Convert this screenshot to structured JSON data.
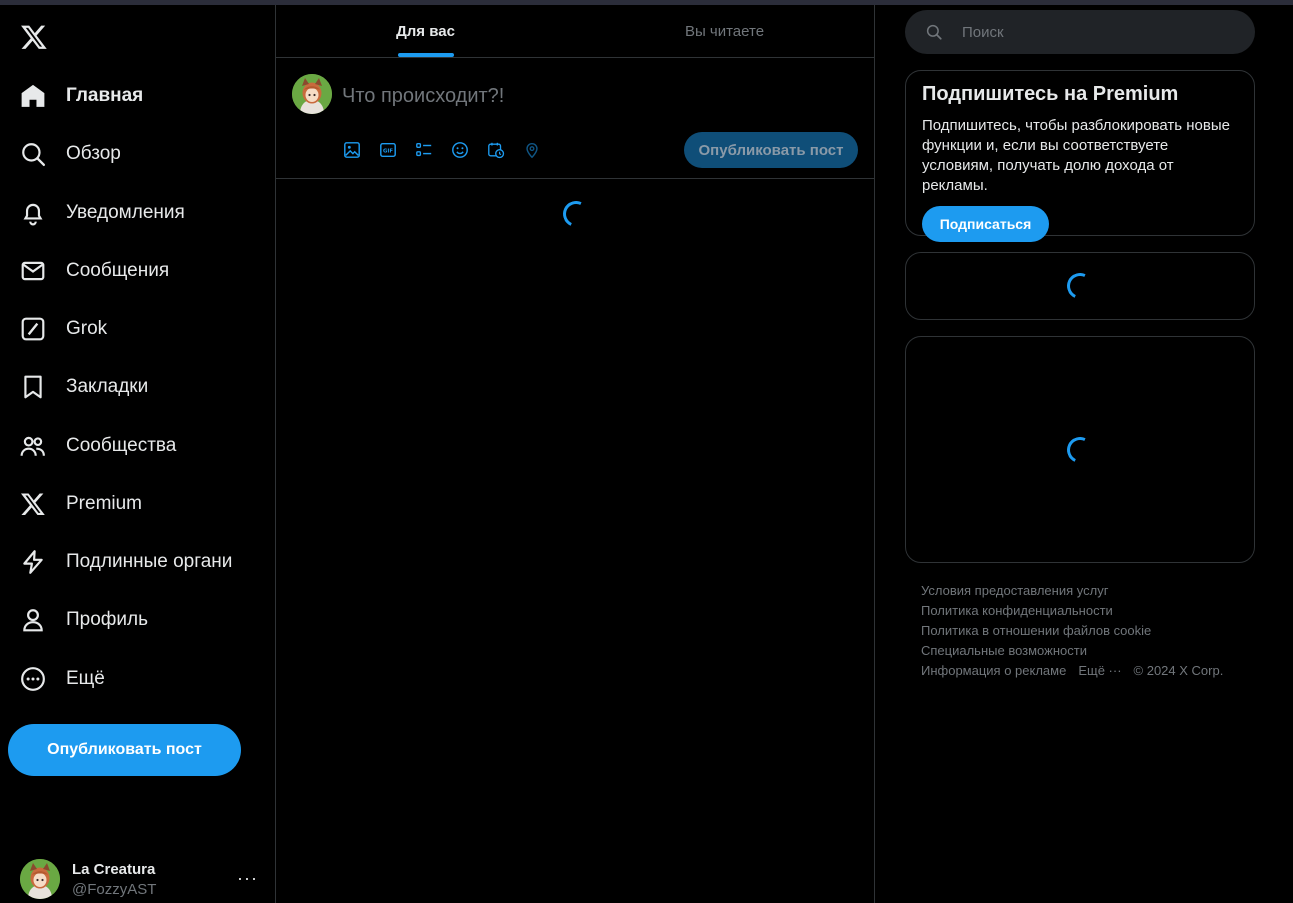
{
  "nav": {
    "items": [
      {
        "label": "Главная",
        "icon": "home-icon"
      },
      {
        "label": "Обзор",
        "icon": "search-icon"
      },
      {
        "label": "Уведомления",
        "icon": "bell-icon"
      },
      {
        "label": "Сообщения",
        "icon": "envelope-icon"
      },
      {
        "label": "Grok",
        "icon": "grok-icon"
      },
      {
        "label": "Закладки",
        "icon": "bookmark-icon"
      },
      {
        "label": "Сообщества",
        "icon": "people-icon"
      },
      {
        "label": "Premium",
        "icon": "x-logo-icon"
      },
      {
        "label": "Подлинные органи",
        "icon": "lightning-icon"
      },
      {
        "label": "Профиль",
        "icon": "person-icon"
      },
      {
        "label": "Ещё",
        "icon": "more-circle-icon"
      }
    ],
    "post_button": "Опубликовать пост"
  },
  "account": {
    "name": "La Creatura",
    "handle": "@FozzyAST",
    "more": "···"
  },
  "main": {
    "tabs": [
      {
        "label": "Для вас",
        "active": true
      },
      {
        "label": "Вы читаете",
        "active": false
      }
    ],
    "composer": {
      "placeholder": "Что происходит?!",
      "publish_button": "Опубликовать пост",
      "tools": [
        "image-icon",
        "gif-icon",
        "poll-icon",
        "emoji-icon",
        "schedule-icon",
        "location-icon"
      ]
    }
  },
  "right": {
    "search_placeholder": "Поиск",
    "premium": {
      "title": "Подпишитесь на Premium",
      "text": "Подпишитесь, чтобы разблокировать новые функции и, если вы соответствуете условиям, получать долю дохода от рекламы.",
      "button": "Подписаться"
    },
    "footer": {
      "links": [
        "Условия предоставления услуг",
        "Политика конфиденциальности",
        "Политика в отношении файлов cookie",
        "Специальные возможности",
        "Информация о рекламе",
        "Ещё ···"
      ],
      "copyright": "© 2024 X Corp."
    }
  },
  "colors": {
    "accent": "#1d9bf0",
    "background": "#000000",
    "border": "#2f3336",
    "text": "#e7e9ea",
    "muted": "#71767b"
  }
}
